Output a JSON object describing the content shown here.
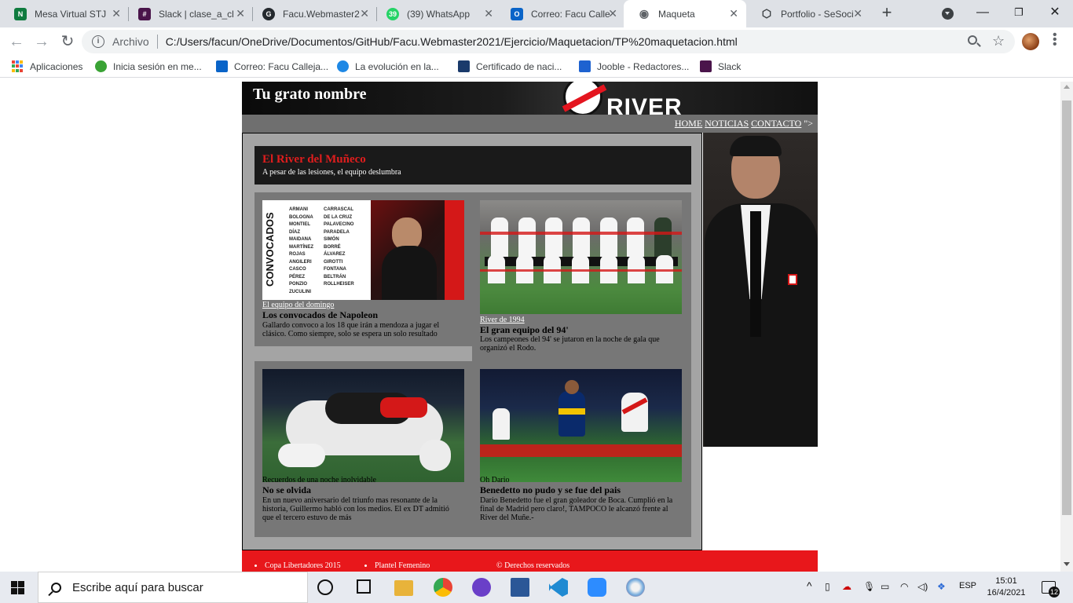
{
  "browser": {
    "tabs": [
      {
        "title": "Mesa Virtual STJ ",
        "icon": "mesa-virtual-icon",
        "color": "#0f7b3f",
        "glyph": "N"
      },
      {
        "title": "Slack | clase_a_cl",
        "icon": "slack-icon",
        "color": "#4a154b",
        "glyph": "#"
      },
      {
        "title": "Facu.Webmaster2",
        "icon": "github-icon",
        "color": "#24292e",
        "glyph": "G"
      },
      {
        "title": "(39) WhatsApp",
        "icon": "whatsapp-icon",
        "color": "#25d366",
        "glyph": "39"
      },
      {
        "title": "Correo: Facu Calle",
        "icon": "outlook-icon",
        "color": "#0a64c8",
        "glyph": "O"
      },
      {
        "title": "Maqueta",
        "icon": "globe-icon",
        "color": "#5f6368",
        "glyph": "◉"
      },
      {
        "title": "Portfolio - SeSoci",
        "icon": "portfolio-icon",
        "color": "#3c4043",
        "glyph": "⬡"
      }
    ],
    "omnibox": {
      "scheme": "Archivo",
      "url": "C:/Users/facun/OneDrive/Documentos/GitHub/Facu.Webmaster2021/Ejercicio/Maquetacion/TP%20maquetacion.html"
    },
    "bookmarks": [
      {
        "label": "Aplicaciones",
        "icon": "apps-grid-icon"
      },
      {
        "label": "Inicia sesión en me...",
        "icon": "login-icon",
        "color": "#3aa335"
      },
      {
        "label": "Correo: Facu Calleja...",
        "icon": "outlook-icon",
        "color": "#0a64c8"
      },
      {
        "label": "La evolución en la...",
        "icon": "evolution-icon",
        "color": "#1e88e5"
      },
      {
        "label": "Certificado de naci...",
        "icon": "certificate-icon",
        "color": "#1a3a6b"
      },
      {
        "label": "Jooble - Redactores...",
        "icon": "jooble-icon",
        "color": "#1e62d0"
      },
      {
        "label": "Slack",
        "icon": "slack-icon",
        "color": "#4a154b"
      }
    ]
  },
  "site": {
    "title": "Tu grato nombre",
    "header_brand": "RIVER",
    "nav": {
      "home": "HOME",
      "noticias": "NOTICIAS",
      "contacto": "CONTACTO",
      "stray": "\">"
    },
    "hero": {
      "title": "El River del Muñeco",
      "subtitle": "A pesar de las lesiones, el equipo deslumbra"
    },
    "cards": [
      {
        "caption": "El equipo del domingo",
        "headline": "Los convocados de Napoleon",
        "body": "Gallardo convoco a los 18 que irán a mendoza a jugar el clásico. Como siempre, solo se espera un solo resultado",
        "image_icon": "convocados-image",
        "image_label": "CONVOCADOS",
        "roster_left": [
          "ARMANI",
          "BOLOGNA",
          "MONTIEL",
          "DÍAZ",
          "MAIDANA",
          "MARTÍNEZ",
          "ROJAS",
          "ANGILERI",
          "CASCO",
          "PÉREZ",
          "PONZIO",
          "ZUCULINI"
        ],
        "roster_right": [
          "CARRASCAL",
          "DE LA CRUZ",
          "PALAVECINO",
          "PARADELA",
          "SIMÓN",
          "BORRÉ",
          "ÁLVAREZ",
          "GIROTTI",
          "FONTANA",
          "BELTRÁN",
          "ROLLHEISER"
        ]
      },
      {
        "caption": "River de 1994",
        "headline": "El gran equipo del 94'",
        "body": "Los campeones del 94' se jutaron en la noche de gala que organizó el Rodo.",
        "image_icon": "team-1994-photo"
      },
      {
        "caption": "Recuerdos de una noche inolvidable",
        "headline": "No se olvida",
        "body": "En un nuevo aniversario del triunfo mas resonante de la historia, Guillermo habló con los medios. El ex DT admitió que el tercero estuvo de más",
        "image_icon": "celebration-photo"
      },
      {
        "caption": "Oh Dario",
        "headline": "Benedetto no pudo y se fue del pais",
        "body": "Dario Benedetto fue el gran goleador de Boca. Cumplió en la final de Madrid pero claro!, TAMPOCO le alcanzó frente al River del Muñe.-",
        "image_icon": "benedetto-photo"
      }
    ],
    "footer": {
      "col1": [
        "Copa Libertadores 2015"
      ],
      "col2": [
        "Plantel Femenino"
      ],
      "copyright": "© Derechos reservados"
    },
    "colors": {
      "accent_red": "#e8171b",
      "river_red": "#e01d1d",
      "panel_gray": "#a4a4a4",
      "card_gray": "#777777"
    }
  },
  "taskbar": {
    "search_placeholder": "Escribe aquí para buscar",
    "language": "ESP",
    "time": "15:01",
    "date": "16/4/2021",
    "notifications": "12"
  }
}
